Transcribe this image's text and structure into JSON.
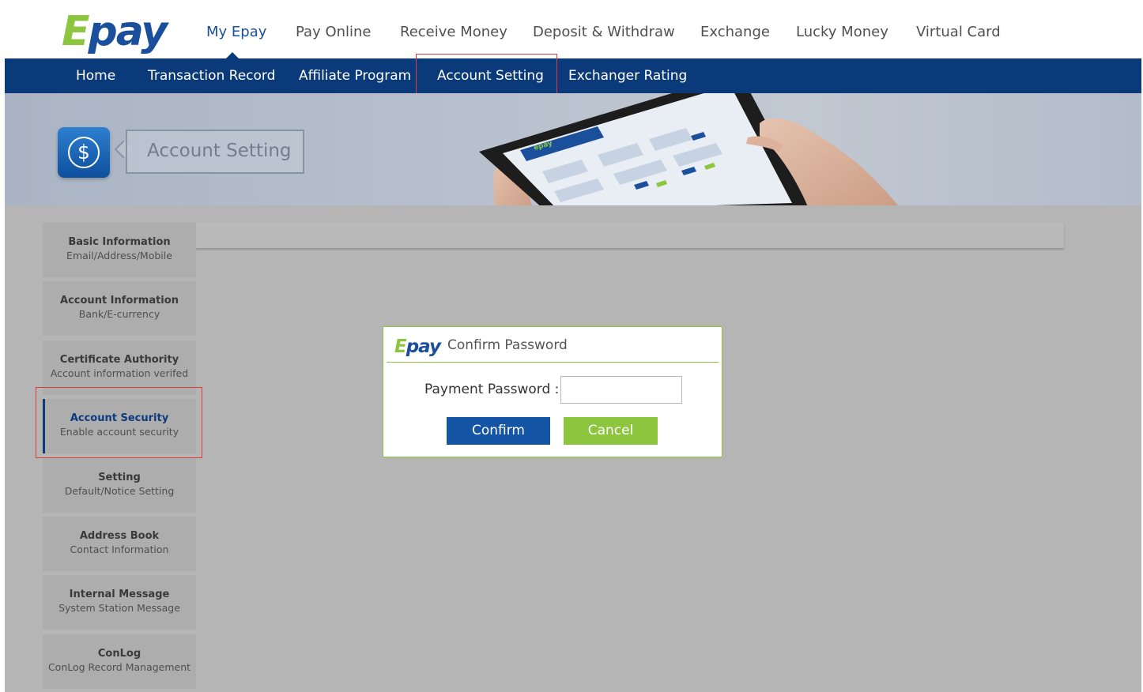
{
  "brand": {
    "logo_text": "Epay"
  },
  "top_nav": {
    "items": [
      {
        "label": "My Epay",
        "active": true
      },
      {
        "label": "Pay Online"
      },
      {
        "label": "Receive Money"
      },
      {
        "label": "Deposit & Withdraw"
      },
      {
        "label": "Exchange"
      },
      {
        "label": "Lucky Money"
      },
      {
        "label": "Virtual Card"
      }
    ]
  },
  "sub_nav": {
    "items": [
      {
        "label": "Home"
      },
      {
        "label": "Transaction Record"
      },
      {
        "label": "Affiliate Program"
      },
      {
        "label": "Account Setting",
        "highlighted": true
      },
      {
        "label": "Exchanger Rating"
      }
    ]
  },
  "banner": {
    "icon": "dollar-circle-icon",
    "title": "Account Setting"
  },
  "sidebar": {
    "items": [
      {
        "title": "Basic Information",
        "subtitle": "Email/Address/Mobile"
      },
      {
        "title": "Account Information",
        "subtitle": "Bank/E-currency"
      },
      {
        "title": "Certificate Authority",
        "subtitle": "Account information verifed"
      },
      {
        "title": "Account Security",
        "subtitle": "Enable account security",
        "active": true
      },
      {
        "title": "Setting",
        "subtitle": "Default/Notice Setting"
      },
      {
        "title": "Address Book",
        "subtitle": "Contact Information"
      },
      {
        "title": "Internal Message",
        "subtitle": "System Station Message"
      },
      {
        "title": "ConLog",
        "subtitle": "ConLog Record Management"
      }
    ]
  },
  "modal": {
    "logo_text": "Epay",
    "title": "Confirm Password",
    "password_label": "Payment Password :",
    "password_value": "",
    "confirm_label": "Confirm",
    "cancel_label": "Cancel"
  },
  "colors": {
    "brand_green": "#8cc63f",
    "brand_blue": "#1a4f9c",
    "nav_blue": "#0b3a7a",
    "highlight_red": "#e03a3a",
    "overlay_gray": "#b5b5b5"
  }
}
